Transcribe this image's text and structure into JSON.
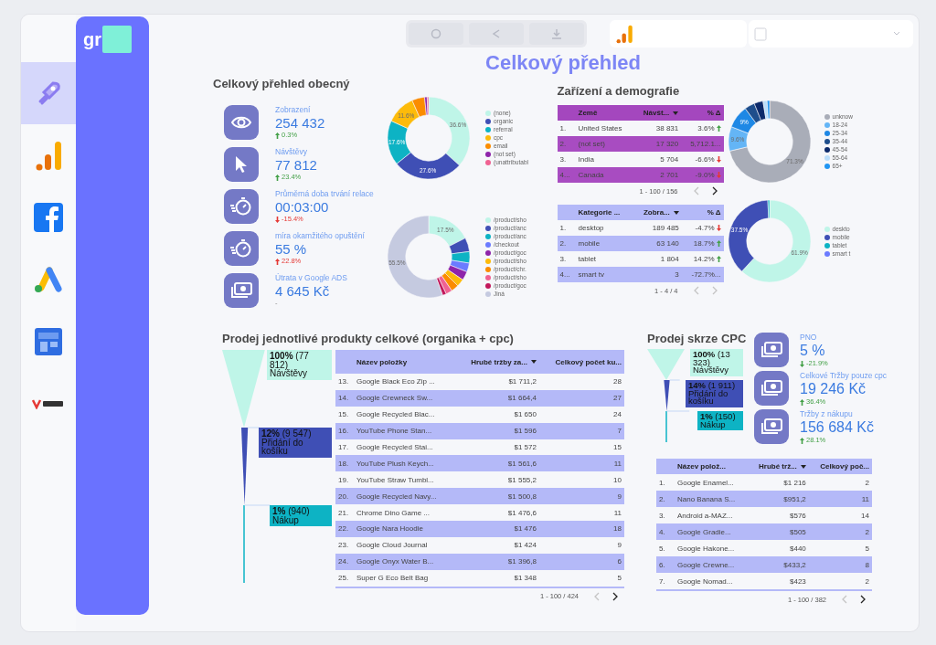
{
  "page_title": "Celkový přehled",
  "logo": {
    "text": "gr"
  },
  "sidebar": {
    "items": [
      {
        "kind": "rocket",
        "selected": true
      },
      {
        "kind": "analytics",
        "selected": false
      },
      {
        "kind": "social",
        "selected": false
      },
      {
        "kind": "ads",
        "selected": false
      },
      {
        "kind": "store",
        "selected": false
      },
      {
        "kind": "wordmark",
        "selected": false
      }
    ]
  },
  "overview": {
    "title": "Celkový přehled obecný",
    "kpis": [
      {
        "kind": "eye",
        "label": "Zobrazení",
        "value": "254 432",
        "change": "0.3%",
        "increase": true,
        "positive": true
      },
      {
        "kind": "cursor",
        "label": "Návštěvy",
        "value": "77 812",
        "change": "23.4%",
        "increase": true,
        "positive": true
      },
      {
        "kind": "stopwatch",
        "label": "Průměrná doba trvání relace",
        "value": "00:03:00",
        "change": "-15.4%",
        "increase": false,
        "positive": false
      },
      {
        "kind": "stopwatch",
        "label": "míra okamžitého opuštění",
        "value": "55 %",
        "change": "22.8%",
        "increase": true,
        "positive": false
      },
      {
        "kind": "money",
        "label": "Útrata v Google ADS",
        "value": "4 645 Kč",
        "change": "-"
      }
    ],
    "charts": [
      {
        "chart_data": {
          "type": "donut",
          "categories": [
            "(none)",
            "organic",
            "referral",
            "cpc",
            "email",
            "(not set)",
            "(unattributabl"
          ],
          "values": [
            36.6,
            27.6,
            17.6,
            11.6,
            5.0,
            1.0,
            0.6
          ],
          "colors": [
            "#bff5e8",
            "#3f4fb5",
            "#0db3c4",
            "#fdbb0a",
            "#fb8c00",
            "#8e24aa",
            "#f06292"
          ],
          "value_labels": [
            "36.6%",
            "27.6%",
            "17.6%",
            "11.6%",
            null,
            null,
            null
          ],
          "legend": "right"
        }
      },
      {
        "chart_data": {
          "type": "donut",
          "categories": [
            "/product/sho",
            "/product/anc",
            "/product/anc",
            "/checkout",
            "/product/goc",
            "/product/sho",
            "/product/chr.",
            "/product/sho",
            "/product/goc",
            "Jiná"
          ],
          "values": [
            17.5,
            5.5,
            4.5,
            3.5,
            3.5,
            3.0,
            3.0,
            2.5,
            1.5,
            55.5
          ],
          "colors": [
            "#bff5e8",
            "#3f4fb5",
            "#0db3c4",
            "#6b7bff",
            "#8e24aa",
            "#fdbb0a",
            "#fb8c00",
            "#f06292",
            "#c2185b",
            "#c5cae0"
          ],
          "value_labels": [
            "17.5%",
            null,
            null,
            null,
            null,
            null,
            null,
            null,
            null,
            "55.5%"
          ],
          "legend": "right"
        }
      }
    ]
  },
  "demography": {
    "title": "Zařízení a demografie",
    "panels": [
      {
        "table": {
          "kind": "purple",
          "columns": [
            {
              "label": "Země"
            },
            {
              "label": "Návšt...",
              "sorted": true
            },
            {
              "label": "% Δ"
            }
          ],
          "rows": [
            {
              "index": "1.",
              "name": "United States",
              "value": "38 831",
              "change": "3.6%",
              "increase": true,
              "positive": true
            },
            {
              "index": "2.",
              "name": "(not set)",
              "value": "17 320",
              "change": "5,712.1..."
            },
            {
              "index": "3.",
              "name": "India",
              "value": "5 704",
              "change": "-6.6%",
              "increase": false,
              "positive": false
            },
            {
              "index": "4...",
              "name": "Canada",
              "value": "2 701",
              "change": "-9.0%",
              "increase": false,
              "positive": false
            }
          ],
          "pagination": {
            "text": "1 - 100 / 156",
            "prev_disabled": true,
            "next_disabled": false
          }
        },
        "chart_data": {
          "type": "donut",
          "categories": [
            "unknow",
            "18-24",
            "25-34",
            "35-44",
            "45-54",
            "55-64",
            "65+"
          ],
          "values": [
            71.3,
            9.6,
            9,
            4,
            3.5,
            1.6,
            1
          ],
          "colors": [
            "#a9adb8",
            "#64b5f6",
            "#1e88e5",
            "#1f4e8c",
            "#0d2a6b",
            "#bbdefb",
            "#2196f3"
          ],
          "value_labels": [
            "71.3%",
            "9.6%",
            "9%",
            null,
            null,
            null,
            null
          ],
          "legend": "right"
        }
      },
      {
        "table": {
          "kind": "lavender",
          "columns": [
            {
              "label": "Kategorie ..."
            },
            {
              "label": "Zobra...",
              "sorted": true
            },
            {
              "label": "% Δ"
            }
          ],
          "rows": [
            {
              "index": "1.",
              "name": "desktop",
              "value": "189 485",
              "change": "-4.7%",
              "increase": false,
              "positive": false
            },
            {
              "index": "2.",
              "name": "mobile",
              "value": "63 140",
              "change": "18.7%",
              "increase": true,
              "positive": true
            },
            {
              "index": "3.",
              "name": "tablet",
              "value": "1 804",
              "change": "14.2%",
              "increase": true,
              "positive": true
            },
            {
              "index": "4...",
              "name": "smart tv",
              "value": "3",
              "change": "-72.7%..."
            }
          ],
          "pagination": {
            "text": "1 - 4 / 4",
            "prev_disabled": true,
            "next_disabled": true
          }
        },
        "chart_data": {
          "type": "donut",
          "categories": [
            "deskto",
            "mobile",
            "tablet",
            "smart t"
          ],
          "values": [
            61.9,
            37.5,
            0.7,
            0
          ],
          "colors": [
            "#bff5e8",
            "#3f4fb5",
            "#0db3c4",
            "#6b7bff"
          ],
          "value_labels": [
            "61.9%",
            "37.5%",
            null,
            null
          ],
          "legend": "right"
        }
      }
    ]
  },
  "products": {
    "title": "Prodej jednotlivé produkty celkové (organika + cpc)",
    "funnel": {
      "stages": [
        {
          "text": "**100%** (77 812) Návštěvy",
          "color": "#bff5e8"
        },
        {
          "text": "**12%** (9 547) Přidání do košíku",
          "color": "#3f4fb5"
        },
        {
          "text": "**1%** (940) Nákup",
          "color": "#0db3c4"
        }
      ]
    },
    "table": {
      "columns": [
        {
          "label": "Název položky"
        },
        {
          "label": "Hrubé tržby za...",
          "sorted": true
        },
        {
          "label": "Celkový počet ku..."
        }
      ],
      "rows": [
        {
          "index": "13.",
          "name": "Google Black Eco Zip ...",
          "revenue": "$1 711,2",
          "count": "28"
        },
        {
          "index": "14.",
          "name": "Google Crewneck Sw...",
          "revenue": "$1 664,4",
          "count": "27"
        },
        {
          "index": "15.",
          "name": "Google Recycled Blac...",
          "revenue": "$1 650",
          "count": "24"
        },
        {
          "index": "16.",
          "name": "YouTube Phone Stan...",
          "revenue": "$1 596",
          "count": "7"
        },
        {
          "index": "17.",
          "name": "Google Recycled Stai...",
          "revenue": "$1 572",
          "count": "15"
        },
        {
          "index": "18.",
          "name": "YouTube Plush Keych...",
          "revenue": "$1 561,6",
          "count": "11"
        },
        {
          "index": "19.",
          "name": "YouTube Straw Tumbl...",
          "revenue": "$1 555,2",
          "count": "10"
        },
        {
          "index": "20.",
          "name": "Google Recycled Navy...",
          "revenue": "$1 500,8",
          "count": "9"
        },
        {
          "index": "21.",
          "name": "Chrome Dino Game ...",
          "revenue": "$1 476,6",
          "count": "11"
        },
        {
          "index": "22.",
          "name": "Google Nara Hoodie",
          "revenue": "$1 476",
          "count": "18"
        },
        {
          "index": "23.",
          "name": "Google Cloud Journal",
          "revenue": "$1 424",
          "count": "9"
        },
        {
          "index": "24.",
          "name": "Google Onyx Water B...",
          "revenue": "$1 396,8",
          "count": "6"
        },
        {
          "index": "25.",
          "name": "Super G Eco Belt Bag",
          "revenue": "$1 348",
          "count": "5"
        }
      ],
      "pagination": {
        "text": "1 - 100 / 424",
        "prev_disabled": true,
        "next_disabled": false
      }
    }
  },
  "cpc": {
    "title": "Prodej skrze CPC",
    "funnel": {
      "stages": [
        {
          "text": "**100%** (13 323) Návštěvy",
          "color": "#bff5e8"
        },
        {
          "text": "**14%** (1 911) Přidání do košíku",
          "color": "#3f4fb5"
        },
        {
          "text": "**1%** (150) Nákup",
          "color": "#0db3c4"
        }
      ]
    },
    "kpis": [
      {
        "kind": "money",
        "label": "PNO",
        "value": "5 %",
        "change": "-21.9%",
        "increase": false,
        "positive": true
      },
      {
        "kind": "money",
        "label": "Celkové Tržby pouze cpc",
        "value": "19 246 Kč",
        "change": "36.4%",
        "increase": true,
        "positive": true
      },
      {
        "kind": "money",
        "label": "Tržby z nákupu",
        "value": "156 684 Kč",
        "change": "28.1%",
        "increase": true,
        "positive": true
      }
    ],
    "table": {
      "columns": [
        {
          "label": "Název polož..."
        },
        {
          "label": "Hrubé trž...",
          "sorted": true
        },
        {
          "label": "Celkový poč..."
        }
      ],
      "rows": [
        {
          "index": "1.",
          "name": "Google Enamel...",
          "revenue": "$1 216",
          "count": "2"
        },
        {
          "index": "2.",
          "name": "Nano Banana S...",
          "revenue": "$951,2",
          "count": "11"
        },
        {
          "index": "3.",
          "name": "Android a-MAZ...",
          "revenue": "$576",
          "count": "14"
        },
        {
          "index": "4.",
          "name": "Google Gradie...",
          "revenue": "$505",
          "count": "2"
        },
        {
          "index": "5.",
          "name": "Google Hakone...",
          "revenue": "$440",
          "count": "5"
        },
        {
          "index": "6.",
          "name": "Google Crewne...",
          "revenue": "$433,2",
          "count": "8"
        },
        {
          "index": "7.",
          "name": "Google Nomad...",
          "revenue": "$423",
          "count": "2"
        }
      ],
      "pagination": {
        "text": "1 - 100 / 382",
        "prev_disabled": true,
        "next_disabled": false
      }
    }
  }
}
